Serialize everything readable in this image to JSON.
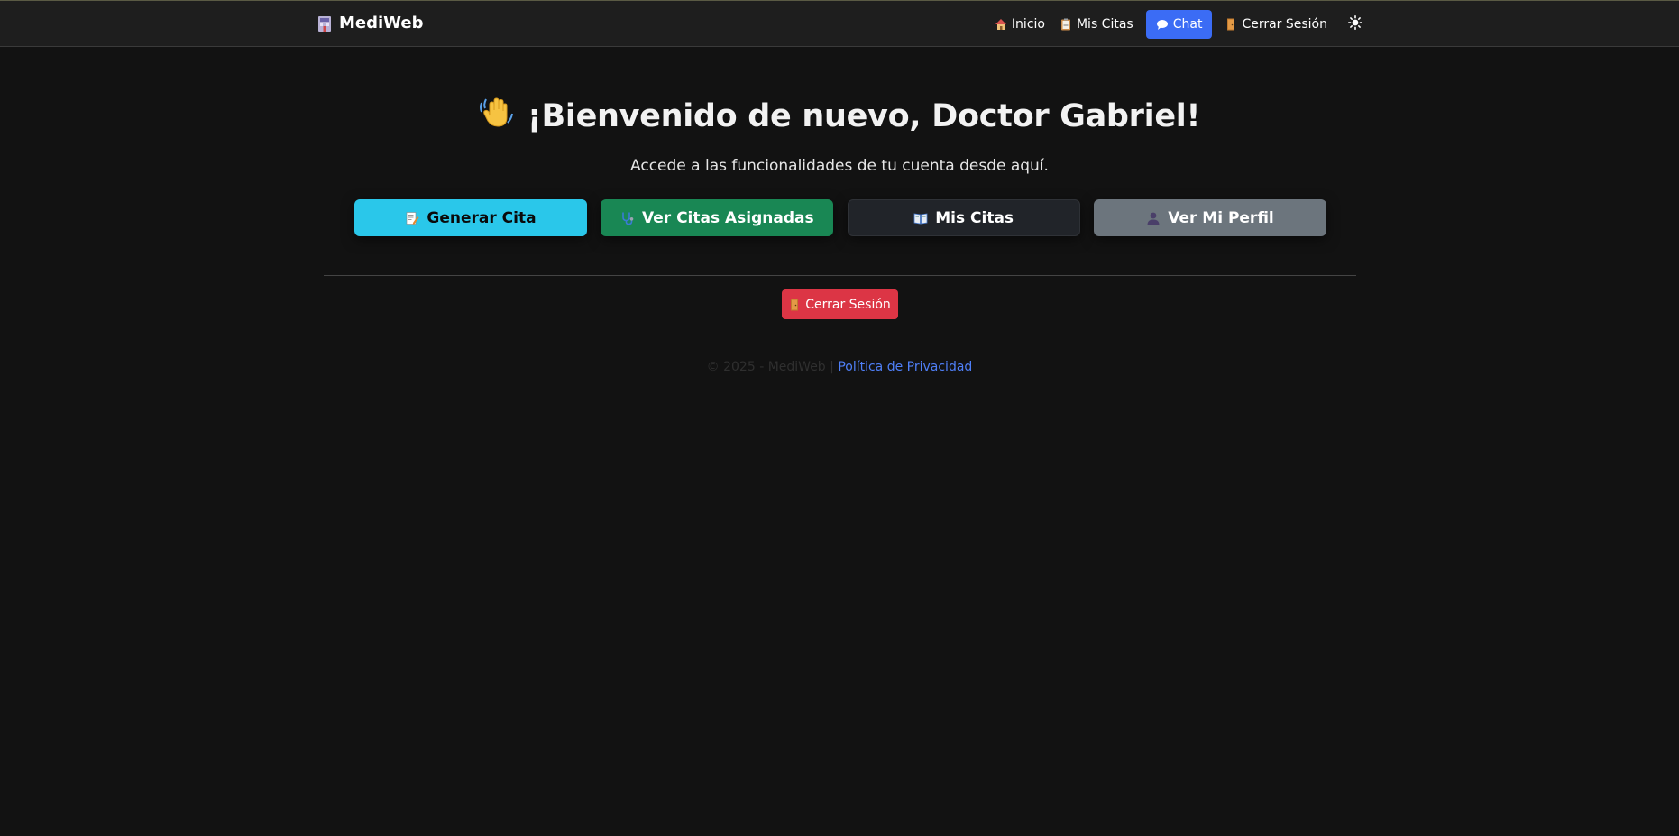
{
  "navbar": {
    "brand": "MediWeb",
    "brand_icon": "hospital-icon",
    "links": [
      {
        "label": "Inicio",
        "icon": "house-icon"
      },
      {
        "label": "Mis Citas",
        "icon": "clipboard-icon"
      },
      {
        "label": "Chat",
        "icon": "speech-bubble-icon",
        "active": true
      },
      {
        "label": "Cerrar Sesión",
        "icon": "door-icon"
      }
    ],
    "theme_toggle_icon": "sun-icon"
  },
  "main": {
    "welcome": "¡Bienvenido de nuevo, Doctor Gabriel!",
    "welcome_icon": "waving-hand-icon",
    "subtitle": "Accede a las funcionalidades de tu cuenta desde aquí.",
    "actions": [
      {
        "label": "Generar Cita",
        "icon": "memo-icon",
        "color": "#2ac7ea"
      },
      {
        "label": "Ver Citas Asignadas",
        "icon": "stethoscope-icon",
        "color": "#198754"
      },
      {
        "label": "Mis Citas",
        "icon": "open-book-icon",
        "color": "#212429"
      },
      {
        "label": "Ver Mi Perfil",
        "icon": "user-icon",
        "color": "#6c757d"
      }
    ],
    "logout_label": "Cerrar Sesión",
    "logout_color": "#dc3545"
  },
  "footer": {
    "copyright": "© 2025 - MediWeb | ",
    "privacy_link": "Política de Privacidad"
  },
  "colors": {
    "background": "#121212",
    "navbar": "#1e1e1e",
    "accent": "#3b6cf5"
  }
}
